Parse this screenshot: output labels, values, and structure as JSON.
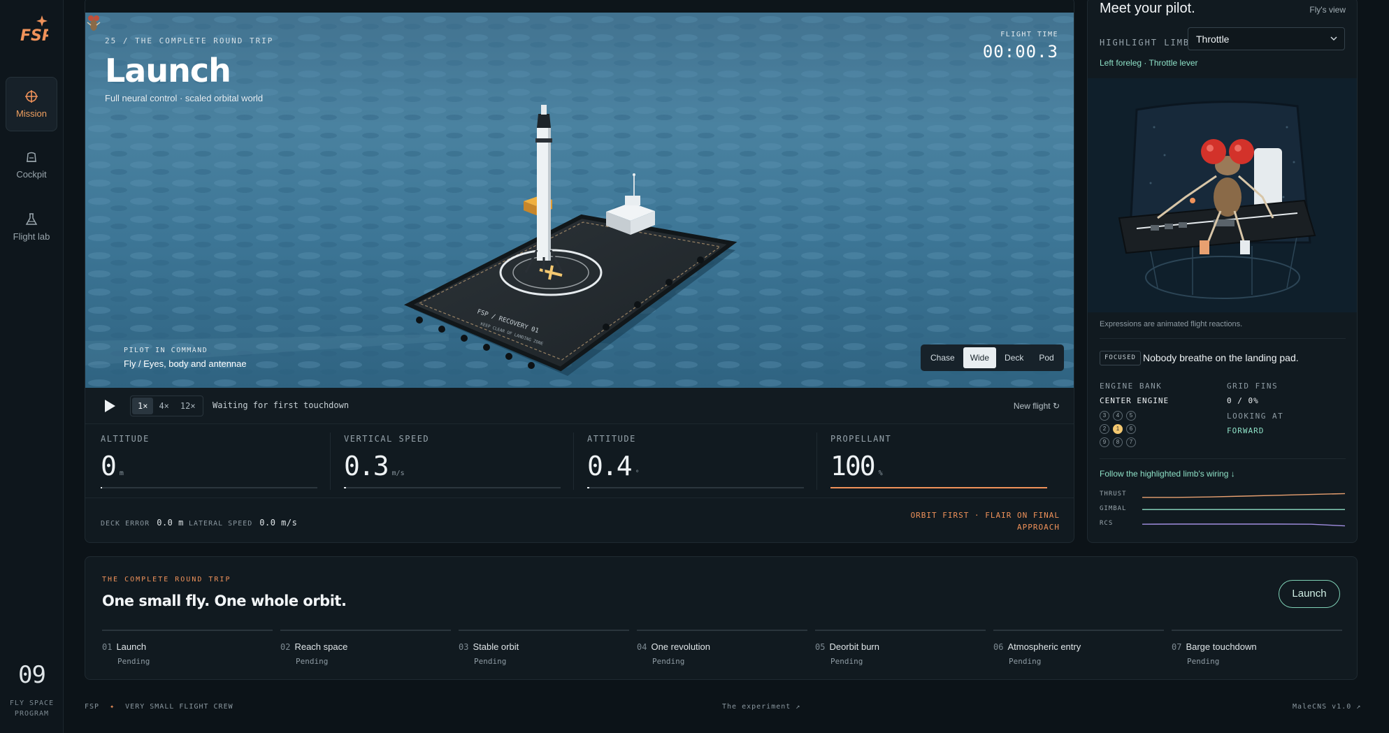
{
  "brand": {
    "logo_text": "FSP",
    "colors": {
      "accent": "#f0925a",
      "teal": "#8ee0c6",
      "bg": "#0c1318"
    }
  },
  "sidebar": {
    "items": [
      {
        "label": "Mission",
        "icon": "crosshair-icon",
        "active": true
      },
      {
        "label": "Cockpit",
        "icon": "cockpit-icon",
        "active": false
      },
      {
        "label": "Flight lab",
        "icon": "flask-icon",
        "active": false
      }
    ],
    "number": "09",
    "subtitle_line1": "FLY SPACE",
    "subtitle_line2": "PROGRAM"
  },
  "scene": {
    "mission_tag": "25 / THE COMPLETE ROUND TRIP",
    "title": "Launch",
    "subtitle": "Full neural control · scaled orbital world",
    "flight_time_label": "FLIGHT TIME",
    "flight_time": "00:00.3",
    "pilot_label": "PILOT IN COMMAND",
    "pilot_value": "Fly / Eyes, body and antennae",
    "deck_text1": "FSP  /  RECOVERY 01",
    "deck_text2": "KEEP CLEAR OF LANDING ZONE",
    "camera_views": [
      "Chase",
      "Wide",
      "Deck",
      "Pod"
    ],
    "camera_selected": "Wide"
  },
  "controls": {
    "speeds": [
      "1×",
      "4×",
      "12×"
    ],
    "speed_selected": "1×",
    "status": "Waiting for first touchdown",
    "new_flight": "New flight ↻"
  },
  "metrics": [
    {
      "label": "ALTITUDE",
      "value": "0",
      "unit": "m",
      "fill": 0.0,
      "color": "white"
    },
    {
      "label": "VERTICAL SPEED",
      "value": "0.3",
      "unit": "m/s",
      "fill": 0.01,
      "color": "white"
    },
    {
      "label": "ATTITUDE",
      "value": "0.4",
      "unit": "°",
      "fill": 0.01,
      "color": "white"
    },
    {
      "label": "PROPELLANT",
      "value": "100",
      "unit": "%",
      "fill": 1.0,
      "color": "orange"
    }
  ],
  "bottom": {
    "deck_error_label": "DECK ERROR",
    "deck_error": "0.0 m",
    "lateral_label": "LATERAL SPEED",
    "lateral": "0.0 m/s",
    "note": "ORBIT FIRST · FLAIR ON FINAL APPROACH"
  },
  "pilot_panel": {
    "title": "Meet your pilot.",
    "view_link": "Fly's view",
    "highlight_label": "HIGHLIGHT LIMB",
    "highlight_value": "Throttle",
    "highlight_sub": "Left foreleg · Throttle lever",
    "expressions_note": "Expressions are animated flight reactions.",
    "mood_badge": "FOCUSED",
    "mood_quote": "Nobody breathe on the landing pad.",
    "engine_bank_label": "ENGINE BANK",
    "engine_bank_value": "CENTER ENGINE",
    "engines": [
      "3",
      "4",
      "5",
      "2",
      "1",
      "6",
      "9",
      "8",
      "7"
    ],
    "engine_active": "1",
    "grid_fins_label": "GRID FINS",
    "grid_fins_value": "0 / 0%",
    "looking_label": "LOOKING AT",
    "looking_value": "FORWARD",
    "follow_link": "Follow the highlighted limb's wiring ↓",
    "signals": [
      {
        "name": "THRUST",
        "color": "#e8a070",
        "trend": [
          0.1,
          0.1,
          0.15,
          0.25,
          0.35,
          0.45,
          0.55
        ]
      },
      {
        "name": "GIMBAL",
        "color": "#8ee0c6",
        "trend": [
          0.4,
          0.4,
          0.4,
          0.4,
          0.4,
          0.4,
          0.4
        ]
      },
      {
        "name": "RCS",
        "color": "#a18ee0",
        "trend": [
          0.4,
          0.42,
          0.42,
          0.42,
          0.42,
          0.4,
          0.2
        ]
      }
    ]
  },
  "timeline": {
    "tag": "THE COMPLETE ROUND TRIP",
    "title": "One small fly. One whole orbit.",
    "launch_button": "Launch",
    "steps": [
      {
        "num": "01",
        "name": "Launch",
        "status": "Pending"
      },
      {
        "num": "02",
        "name": "Reach space",
        "status": "Pending"
      },
      {
        "num": "03",
        "name": "Stable orbit",
        "status": "Pending"
      },
      {
        "num": "04",
        "name": "One revolution",
        "status": "Pending"
      },
      {
        "num": "05",
        "name": "Deorbit burn",
        "status": "Pending"
      },
      {
        "num": "06",
        "name": "Atmospheric entry",
        "status": "Pending"
      },
      {
        "num": "07",
        "name": "Barge touchdown",
        "status": "Pending"
      }
    ]
  },
  "footer": {
    "left": "FSP",
    "left_sep": "✦",
    "left_tail": "VERY SMALL FLIGHT CREW",
    "center": "The experiment ↗",
    "right": "MaleCNS v1.0 ↗"
  }
}
